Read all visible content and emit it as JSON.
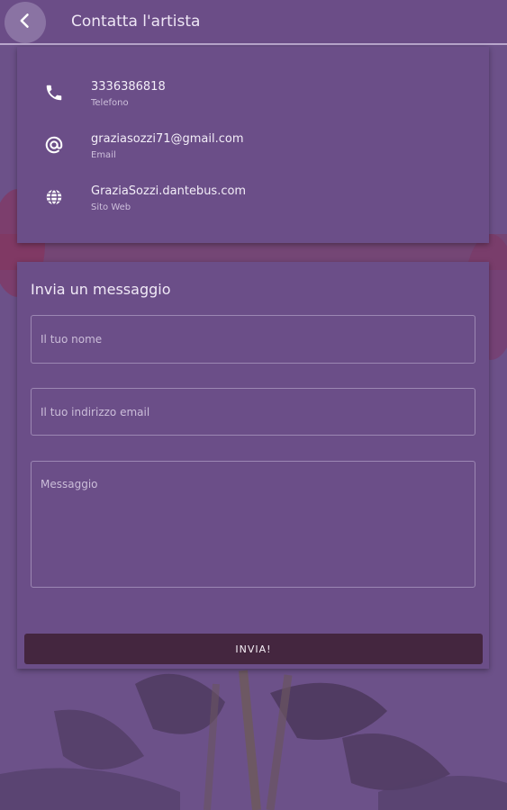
{
  "header": {
    "title": "Contatta l'artista",
    "back_icon": "chevron-left-icon"
  },
  "contact": [
    {
      "icon": "phone-icon",
      "value": "3336386818",
      "label": "Telefono"
    },
    {
      "icon": "at-sign-icon",
      "value": "graziasozzi71@gmail.com",
      "label": "Email"
    },
    {
      "icon": "globe-icon",
      "value": "GraziaSozzi.dantebus.com",
      "label": "Sito Web"
    }
  ],
  "form": {
    "title": "Invia un messaggio",
    "name_placeholder": "Il tuo nome",
    "email_placeholder": "Il tuo indirizzo email",
    "message_placeholder": "Messaggio",
    "send_label": "INVIA!"
  },
  "colors": {
    "primary": "#6b4e88",
    "button": "#44263f",
    "accent_red": "#9e2b49"
  }
}
